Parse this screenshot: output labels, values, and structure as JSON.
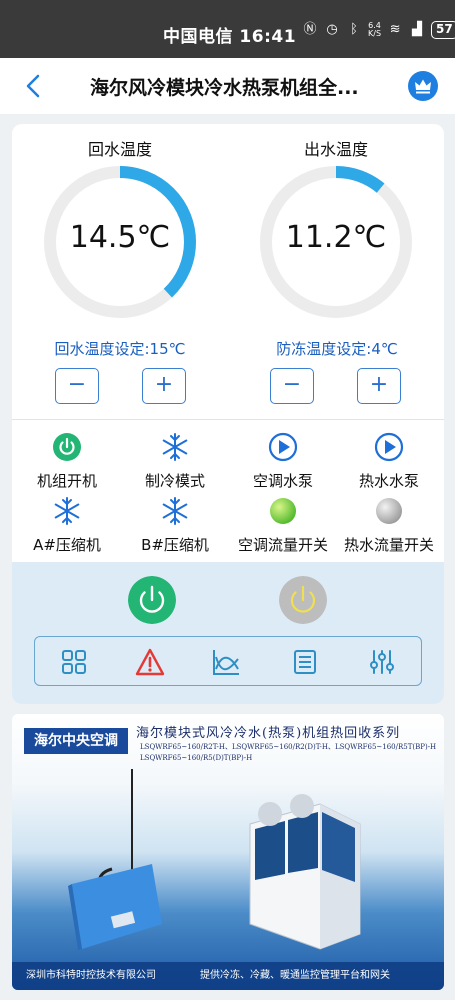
{
  "status_bar": {
    "carrier_time": "中国电信 16:41",
    "net_speed_value": "6.4",
    "net_speed_unit": "K/S",
    "battery": "57"
  },
  "header": {
    "title": "海尔风冷模块冷水热泵机组全..."
  },
  "gauges": {
    "return": {
      "label": "回水温度",
      "value": "14.5℃",
      "level": 0.38
    },
    "outlet": {
      "label": "出水温度",
      "value": "11.2℃",
      "level": 0.11
    }
  },
  "settings": {
    "return_set": "回水温度设定:15℃",
    "antifreeze_set": "防冻温度设定:4℃",
    "minus": "−",
    "plus": "+"
  },
  "status_items": [
    {
      "label": "机组开机",
      "icon": "power-icon"
    },
    {
      "label": "制冷模式",
      "icon": "snowflake-icon"
    },
    {
      "label": "空调水泵",
      "icon": "play-icon"
    },
    {
      "label": "热水水泵",
      "icon": "play-icon"
    },
    {
      "label": "A#压缩机",
      "icon": "snowflake-icon"
    },
    {
      "label": "B#压缩机",
      "icon": "snowflake-icon"
    },
    {
      "label": "空调流量开关",
      "icon": "green-dot-icon"
    },
    {
      "label": "热水流量开关",
      "icon": "grey-dot-icon"
    }
  ],
  "colors": {
    "accent": "#2a6fcf",
    "gauge_arc": "#2fa8e8",
    "power_on": "#22b573",
    "power_off": "#bdbdbd",
    "alarm": "#e53935"
  },
  "banner": {
    "brand": "海尔中央空调",
    "title": "海尔模块式风冷冷水(热泵)机组热回收系列",
    "models_line1": "LSQWRF65~160/R2T-H、LSQWRF65~160/R2(D)T-H、LSQWRF65~160/R5T(BP)-H",
    "models_line2": "LSQWRF65~160/R5(D)T(BP)-H",
    "footer_left": "深圳市科特时控技术有限公司",
    "footer_right": "提供冷冻、冷藏、暖通监控管理平台和网关"
  }
}
